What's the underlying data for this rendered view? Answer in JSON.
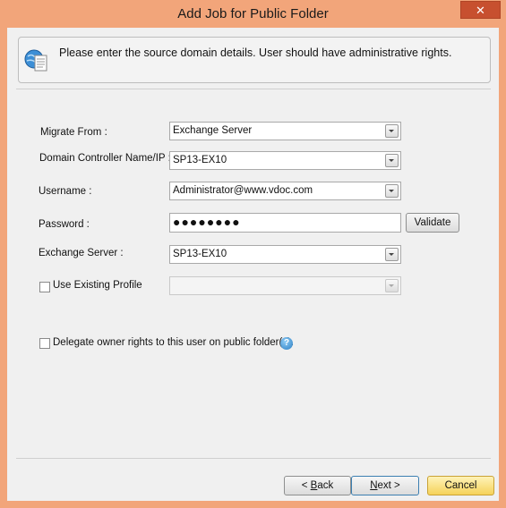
{
  "window": {
    "title": "Add Job for Public Folder",
    "close_glyph": "✕"
  },
  "info": {
    "icon": "globe-document-icon",
    "text": "Please enter the source domain details. User should have administrative rights."
  },
  "form": {
    "migrate_from": {
      "label": "Migrate From :",
      "value": "Exchange Server"
    },
    "domain_controller": {
      "label": "Domain Controller Name/IP :",
      "value": "SP13-EX10"
    },
    "username": {
      "label": "Username :",
      "value": "Administrator@www.vdoc.com"
    },
    "password": {
      "label": "Password :",
      "value": "●●●●●●●●"
    },
    "validate_button": "Validate",
    "exchange_server": {
      "label": "Exchange Server :",
      "value": "SP13-EX10"
    },
    "use_existing_profile": {
      "label": "Use Existing Profile",
      "checked": false,
      "value": ""
    },
    "delegate_rights": {
      "label": "Delegate owner rights to this user on public folder(s).",
      "checked": false
    }
  },
  "footer": {
    "back_prefix": "< ",
    "back_key": "B",
    "back_rest": "ack",
    "next_key": "N",
    "next_rest": "ext >",
    "cancel": "Cancel"
  },
  "colors": {
    "frame": "#f2a57a",
    "close": "#c7502f",
    "cancel": "#f5d25a"
  }
}
